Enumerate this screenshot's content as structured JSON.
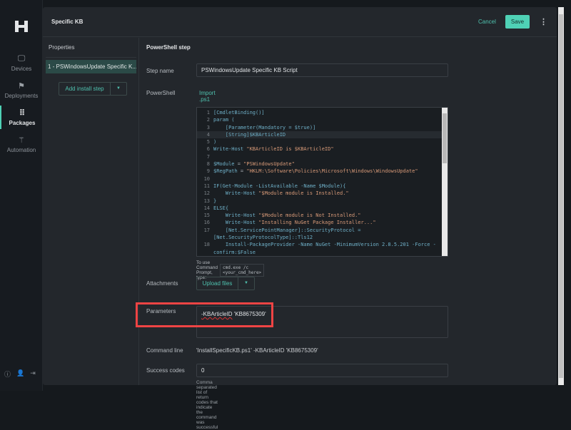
{
  "nav": {
    "items": [
      {
        "label": "Devices",
        "icon": "monitor-icon"
      },
      {
        "label": "Deployments",
        "icon": "flag-icon"
      },
      {
        "label": "Packages",
        "icon": "grid-icon",
        "active": true
      },
      {
        "label": "Automation",
        "icon": "magic-wand-icon"
      }
    ]
  },
  "header": {
    "title": "Specific KB",
    "cancel": "Cancel",
    "save": "Save"
  },
  "properties": {
    "heading": "Properties",
    "step": "1 - PSWindowsUpdate Specific K...",
    "add_step": "Add install step"
  },
  "main": {
    "section": "PowerShell step",
    "step_name_label": "Step name",
    "step_name_value": "PSWindowsUpdate Specific KB Script",
    "powershell_label": "PowerShell",
    "import_link": "Import .ps1",
    "code": [
      [
        [
          "[CmdletBinding()]",
          "k"
        ]
      ],
      [
        [
          "param (",
          "k"
        ]
      ],
      [
        [
          "    [Parameter(Mandatory = $true)]",
          "k"
        ]
      ],
      [
        [
          "    [String]$KBArticleID",
          "k"
        ]
      ],
      [
        [
          ")",
          "k"
        ]
      ],
      [
        [
          "Write-Host ",
          "k"
        ],
        [
          "\"KBArticleID is $KBArticleID\"",
          "s"
        ]
      ],
      [
        [
          "",
          "k"
        ]
      ],
      [
        [
          "$Module",
          "k"
        ],
        [
          " = ",
          "p"
        ],
        [
          "\"PSWindowsUpdate\"",
          "s"
        ]
      ],
      [
        [
          "$RegPath",
          "k"
        ],
        [
          " = ",
          "p"
        ],
        [
          "\"HKLM:\\Software\\Policies\\Microsoft\\Windows\\WindowsUpdate\"",
          "s"
        ]
      ],
      [
        [
          "",
          "k"
        ]
      ],
      [
        [
          "IF(Get-Module -ListAvailable -Name $Module){",
          "k"
        ]
      ],
      [
        [
          "    Write-Host ",
          "k"
        ],
        [
          "\"$Module module is Installed.\"",
          "s"
        ]
      ],
      [
        [
          "}",
          "k"
        ]
      ],
      [
        [
          "ELSE{",
          "k"
        ]
      ],
      [
        [
          "    Write-Host ",
          "k"
        ],
        [
          "\"$Module module is Not Installed.\"",
          "s"
        ]
      ],
      [
        [
          "    Write-Host ",
          "k"
        ],
        [
          "\"Installing NuGet Package Installer...\"",
          "s"
        ]
      ],
      [
        [
          "    [Net.ServicePointManager]::SecurityProtocol =",
          "k"
        ]
      ],
      [
        [
          "[Net.SecurityProtocolType]::Tls12",
          "k"
        ]
      ],
      [
        [
          "    Install-PackageProvider -Name NuGet -MinimumVersion 2.8.5.201 -Force -",
          "k"
        ]
      ],
      [
        [
          "confirm:$False",
          "k"
        ]
      ]
    ],
    "line_numbers": [
      "1",
      "2",
      "3",
      "4",
      "5",
      "6",
      "7",
      "8",
      "9",
      "10",
      "11",
      "12",
      "13",
      "14",
      "15",
      "16",
      "17",
      "",
      "18",
      ""
    ],
    "hint": "To use Command Prompt, type:",
    "hint_code": "cmd.exe /c <your_cmd_here>",
    "attachments_label": "Attachments",
    "upload": "Upload files",
    "parameters_label": "Parameters",
    "parameters_flag": "-KBArticleID",
    "parameters_rest": " 'KB8675309'",
    "command_line_label": "Command line",
    "command_line_value": "'InstallSpecificKB.ps1' -KBArticleID 'KB8675309'",
    "success_label": "Success codes",
    "success_value": "0",
    "success_hint": "Comma separated list of return codes that indicate the command was successful"
  }
}
